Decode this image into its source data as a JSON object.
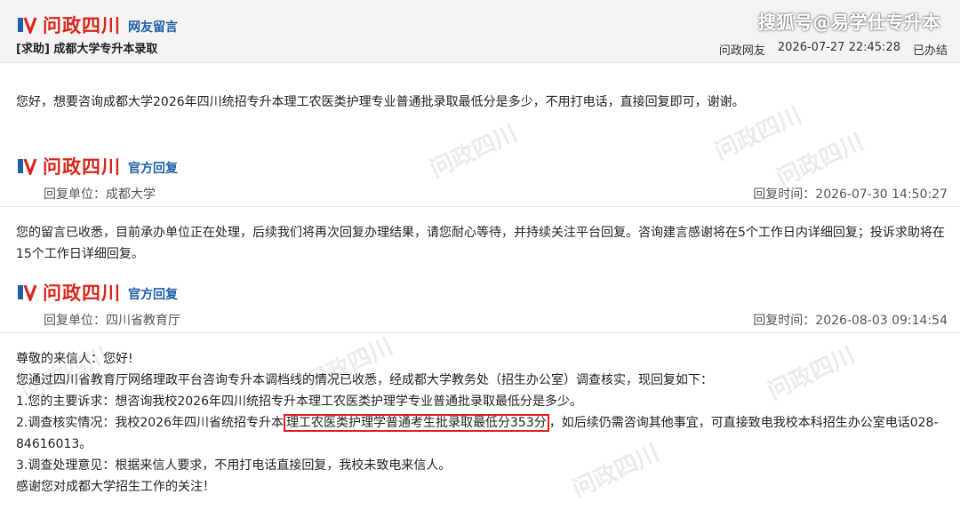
{
  "header": {
    "brand": "问政四川",
    "sub": "网友留言",
    "question_title": "[求助] 成都大学专升本录取",
    "author": "问政网友",
    "datetime": "2026-07-27 22:45:28",
    "status": "已办结",
    "source_watermark": "搜狐号@易学仕专升本"
  },
  "question": {
    "text": "您好，想要咨询成都大学2026年四川统招专升本理工农医类护理专业普通批录取最低分是多少，不用打电话，直接回复即可，谢谢。"
  },
  "reply1": {
    "brand": "问政四川",
    "sub": "官方回复",
    "unit": "回复单位：成都大学",
    "time": "回复时间：2026-07-30 14:50:27",
    "body": "您的留言已收悉，目前承办单位正在处理，后续我们将再次回复办理结果，请您耐心等待，并持续关注平台回复。咨询建言感谢将在5个工作日内详细回复；投诉求助将在15个工作日详细回复。"
  },
  "reply2": {
    "brand": "问政四川",
    "sub": "官方回复",
    "unit": "回复单位：四川省教育厅",
    "time": "回复时间：2026-08-03 09:14:54",
    "lines": {
      "l1": "尊敬的来信人：您好!",
      "l2": "您通过四川省教育厅网络理政平台咨询专升本调档线的情况已收悉，经成都大学教务处（招生办公室）调查核实，现回复如下：",
      "l3": "1.您的主要诉求：想咨询我校2026年四川统招专升本理工农医类护理学专业普通批录取最低分是多少。",
      "l4_pre": "2.调查核实情况：我校2026年四川省统招专升本",
      "l4_hl": "理工农医类护理学普通考生批录取最低分353分",
      "l4_post": "，如后续仍需咨询其他事宜，可直接致电我校本科招生办公室电话028-84616013。",
      "l5": "3.调查处理意见：根据来信人要求，不用打电话直接回复，我校未致电来信人。",
      "l6": "感谢您对成都大学招生工作的关注！"
    }
  },
  "watermark_text": "问政四川",
  "colors": {
    "brand_red": "#d9261c",
    "brand_blue": "#1f5fa8",
    "highlight": "#e02020"
  }
}
